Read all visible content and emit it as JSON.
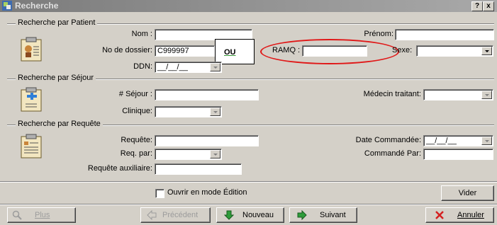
{
  "window": {
    "title": "Recherche",
    "help_btn": "?",
    "close_btn": "x"
  },
  "patient": {
    "legend": "Recherche par Patient",
    "nom_label": "Nom :",
    "nom_value": "",
    "prenom_label": "Prénom:",
    "prenom_value": "",
    "dossier_label": "No de dossier:",
    "dossier_value": "C999997",
    "ou_label": "OU",
    "ramq_label": "RAMQ :",
    "ramq_value": "",
    "sexe_label": "Sexe:",
    "sexe_value": "",
    "ddn_label": "DDN:",
    "ddn_value": "__/__/__"
  },
  "sejour": {
    "legend": "Recherche par Séjour",
    "sejour_label": "# Séjour :",
    "sejour_value": "",
    "medecin_label": "Médecin traitant:",
    "medecin_value": "",
    "clinique_label": "Clinique:",
    "clinique_value": ""
  },
  "requete": {
    "legend": "Recherche par Requête",
    "requete_label": "Requête:",
    "requete_value": "",
    "date_label": "Date Commandée:",
    "date_value": "__/__/__",
    "reqpar_label": "Req. par:",
    "reqpar_value": "",
    "commande_label": "Commandé Par:",
    "commande_value": "",
    "aux_label": "Requête auxiliaire:",
    "aux_value": ""
  },
  "options": {
    "edit_mode_label": "Ouvrir en mode Édition",
    "edit_mode_checked": false
  },
  "buttons": {
    "vider": "Vider",
    "plus": "Plus",
    "precedent": "Précédent",
    "nouveau": "Nouveau",
    "suivant": "Suivant",
    "annuler": "Annuler"
  },
  "colors": {
    "annotation_red": "#e01818",
    "titlebar": "#7b7b7b",
    "face": "#d4d0c8"
  }
}
